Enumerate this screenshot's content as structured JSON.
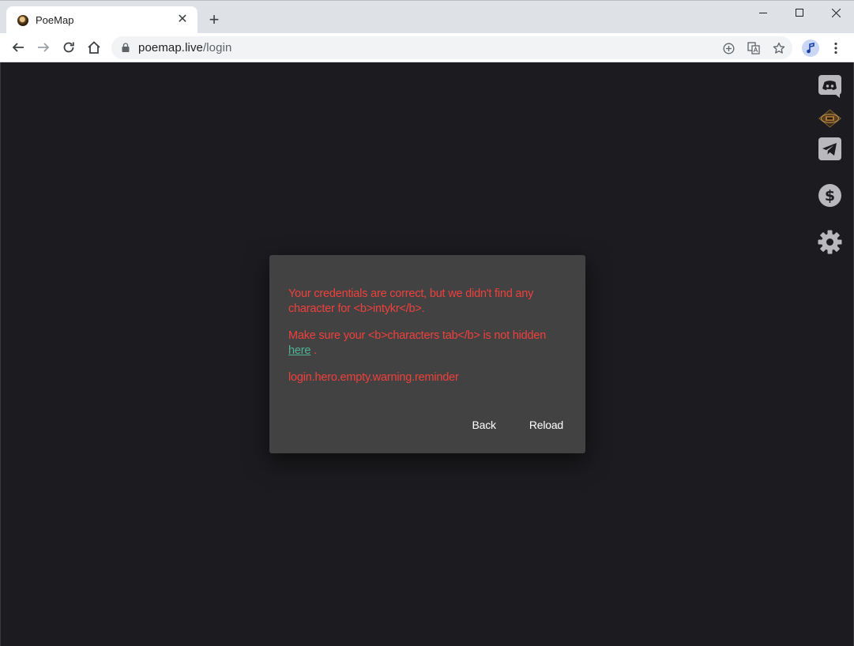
{
  "browser": {
    "tab_title": "PoeMap",
    "tab_close": "✕",
    "new_tab": "+",
    "url_host": "poemap.live",
    "url_path": "/login"
  },
  "sidebar": {
    "icons": [
      "discord-icon",
      "poe-trade-icon",
      "telegram-icon",
      "donate-icon",
      "settings-icon"
    ]
  },
  "dialog": {
    "line1": "Your credentials are correct, but we didn't find any character for <b>intykr</b>.",
    "line2_prefix": "Make sure your <b>characters tab</b> is not hidden",
    "link_text": "here",
    "line2_suffix": " .",
    "line3": "login.hero.empty.warning.reminder",
    "back_label": "Back",
    "reload_label": "Reload"
  },
  "colors": {
    "error_text": "#f0403c",
    "link": "#4fb394",
    "dialog_bg": "#424242",
    "page_bg": "#1c1c20"
  }
}
